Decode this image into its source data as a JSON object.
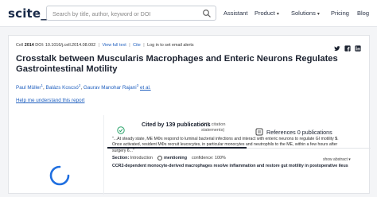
{
  "header": {
    "logo": "scite_",
    "search_placeholder": "Search by title, author, keyword or DOI",
    "nav": [
      {
        "label": "Assistant",
        "has_menu": false
      },
      {
        "label": "Product",
        "has_menu": true
      },
      {
        "label": "Solutions",
        "has_menu": true
      },
      {
        "label": "Pricing",
        "has_menu": false
      },
      {
        "label": "Blog",
        "has_menu": false
      }
    ]
  },
  "article": {
    "journal": "Cell",
    "year": "2014",
    "doi_text": "DOI: 10.1016/j.cell.2014.08.002",
    "view_full_text": "View full text",
    "cite": "Cite",
    "email_alerts": "Log in to set email alerts",
    "title": "Crosstalk between Muscularis Macrophages and Enteric Neurons Regulates Gastrointestinal Motility",
    "authors": [
      {
        "name": "Paul Müller",
        "sup": "1"
      },
      {
        "name": "Balázs Koscsó",
        "sup": "2"
      },
      {
        "name": "Gaurav Manohar Rajani",
        "sup": "3"
      }
    ],
    "et_al": "et al.",
    "help_link": "Help me understand this report"
  },
  "tabs": {
    "cited": {
      "label": "Cited by 139 publications",
      "sub": "(171 citation statements)"
    },
    "references": {
      "label": "References 0 publications"
    }
  },
  "citation": {
    "quote_pre": "\"...At steady state, ME MΦs respond to luminal bacterial infections and interact with enteric neurons to regulate GI motility ",
    "ref_num": "5",
    "quote_post": ". Once activated, resident MΦs recruit leucocytes, in particular monocytes and neutrophils to the ME, within a few hours after surgery 6...\"",
    "section_label": "Section:",
    "section_value": "Introduction",
    "mention_label": "mentioning",
    "confidence_label": "confidence: 100%",
    "show_abstract": "show abstract",
    "citing_title": "CCR2-dependent monocyte-derived macrophages resolve inflammation and restore gut motility in postoperative ileus"
  },
  "colors": {
    "brand": "#1a2b4a",
    "link": "#1f5fbf",
    "spinner": "#1f6fe0",
    "cited_icon": "#29a36a"
  },
  "icons": [
    "search-icon",
    "twitter-icon",
    "facebook-icon",
    "linkedin-icon",
    "cited-by-icon",
    "references-icon",
    "loading-spinner-icon",
    "mentioning-icon",
    "chevron-down-icon"
  ]
}
